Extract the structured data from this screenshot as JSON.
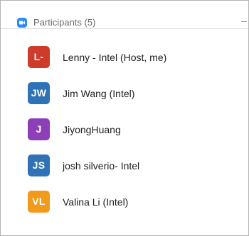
{
  "window": {
    "title": "Participants (5)",
    "minimize_glyph": "–"
  },
  "participants": [
    {
      "initials": "L-",
      "name": "Lenny - Intel (Host, me)",
      "color": "#cf3b2b"
    },
    {
      "initials": "JW",
      "name": "Jim Wang (Intel)",
      "color": "#2f72b6"
    },
    {
      "initials": "J",
      "name": "JiyongHuang",
      "color": "#8c3fb6"
    },
    {
      "initials": "JS",
      "name": "josh silverio- Intel",
      "color": "#2f72b6"
    },
    {
      "initials": "VL",
      "name": "Valina Li (Intel)",
      "color": "#f29a1a"
    }
  ],
  "icons": {
    "app": "zoom-camera-icon"
  }
}
